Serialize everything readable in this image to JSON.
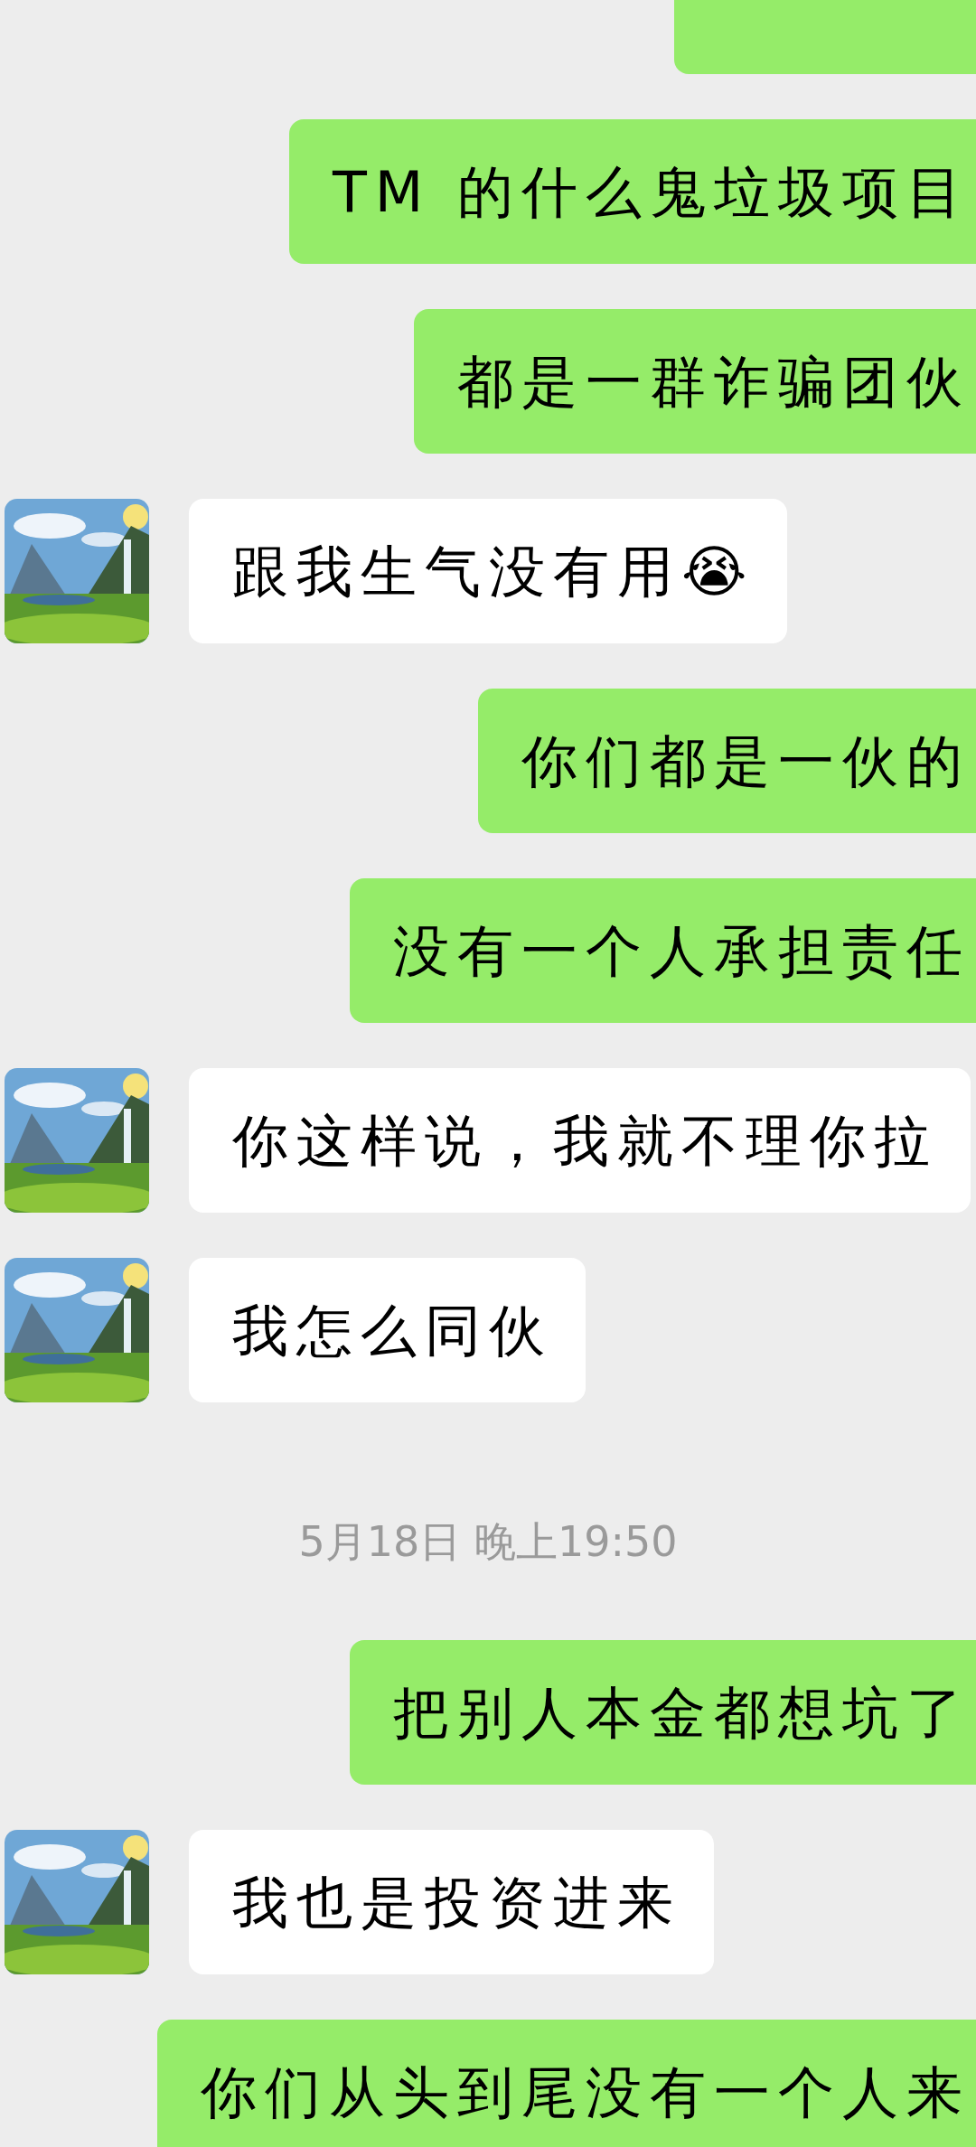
{
  "messages": [
    {
      "kind": "outgoing_cut"
    },
    {
      "kind": "outgoing",
      "text": "TM 的什么鬼垃圾项目"
    },
    {
      "kind": "outgoing",
      "text": "都是一群诈骗团伙"
    },
    {
      "kind": "incoming",
      "text": "跟我生气没有用😭"
    },
    {
      "kind": "outgoing",
      "text": "你们都是一伙的"
    },
    {
      "kind": "outgoing",
      "text": "没有一个人承担责任"
    },
    {
      "kind": "incoming",
      "text": "你这样说，我就不理你拉"
    },
    {
      "kind": "incoming",
      "text": "我怎么同伙"
    },
    {
      "kind": "time",
      "text": "5月18日 晚上19:50"
    },
    {
      "kind": "outgoing",
      "text": "把别人本金都想坑了"
    },
    {
      "kind": "incoming",
      "text": "我也是投资进来"
    },
    {
      "kind": "outgoing",
      "text": "你们从头到尾没有一个人来"
    }
  ]
}
